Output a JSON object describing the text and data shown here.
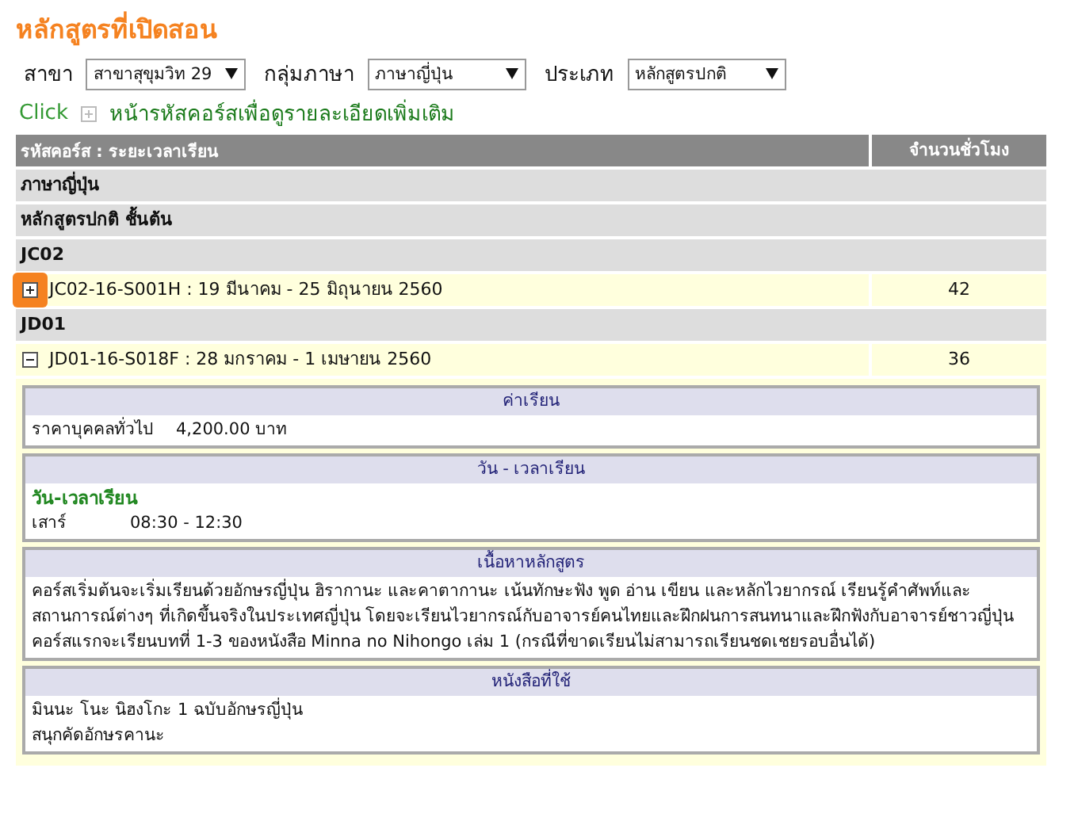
{
  "page_title": "หลักสูตรที่เปิดสอน",
  "filters": [
    {
      "label": "สาขา",
      "value": "สาขาสุขุมวิท 29"
    },
    {
      "label": "กลุ่มภาษา",
      "value": "ภาษาญี่ปุ่น"
    },
    {
      "label": "ประเภท",
      "value": "หลักสูตรปกติ"
    }
  ],
  "hint": {
    "click": "Click",
    "text": "หน้ารหัสคอร์สเพื่อดูรายละเอียดเพิ่มเติม"
  },
  "table": {
    "columns": [
      "รหัสคอร์ส : ระยะเวลาเรียน",
      "จำนวนชั่วโมง"
    ],
    "rows": [
      {
        "kind": "group",
        "label": "ภาษาญี่ปุ่น"
      },
      {
        "kind": "group",
        "label": "หลักสูตรปกติ ชั้นต้น"
      },
      {
        "kind": "group",
        "label": "JC02"
      },
      {
        "kind": "course",
        "label": "JC02-16-S001H : 19 มีนาคม - 25 มิถุนายน 2560",
        "hours": "42",
        "expanded": false,
        "highlighted": true
      },
      {
        "kind": "group",
        "label": "JD01"
      },
      {
        "kind": "course",
        "label": "JD01-16-S018F : 28 มกราคม - 1 เมษายน 2560",
        "hours": "36",
        "expanded": true,
        "highlighted": false
      }
    ]
  },
  "details": [
    {
      "kind": "price",
      "heading": "ค่าเรียน",
      "label": "ราคาบุคคลทั่วไป",
      "value": "4,200.00 บาท"
    },
    {
      "kind": "schedule",
      "heading": "วัน - เวลาเรียน",
      "subtitle": "วัน-เวลาเรียน",
      "day": "เสาร์",
      "time": "08:30 - 12:30"
    },
    {
      "kind": "text",
      "heading": "เนื้อหาหลักสูตร",
      "lines": [
        "คอร์สเริ่มต้นจะเริ่มเรียนด้วยอักษรญี่ปุ่น ฮิรากานะ และคาตากานะ เน้นทักษะฟัง พูด อ่าน เขียน และหลักไวยากรณ์ เรียนรู้คำศัพท์และสถานการณ์ต่างๆ ที่เกิดขึ้นจริงในประเทศญี่ปุ่น โดยจะเรียนไวยากรณ์กับอาจารย์คนไทยและฝึกฝนการสนทนาและฝึกฟังกับอาจารย์ชาวญี่ปุ่น คอร์สแรกจะเรียนบทที่ 1-3 ของหนังสือ Minna no Nihongo เล่ม 1 (กรณีที่ขาดเรียนไม่สามารถเรียนชดเชยรอบอื่นได้)"
      ]
    },
    {
      "kind": "text",
      "heading": "หนังสือที่ใช้",
      "lines": [
        "มินนะ โนะ นิฮงโกะ 1 ฉบับอักษรญี่ปุ่น",
        "สนุกคัดอักษรคานะ"
      ]
    }
  ]
}
